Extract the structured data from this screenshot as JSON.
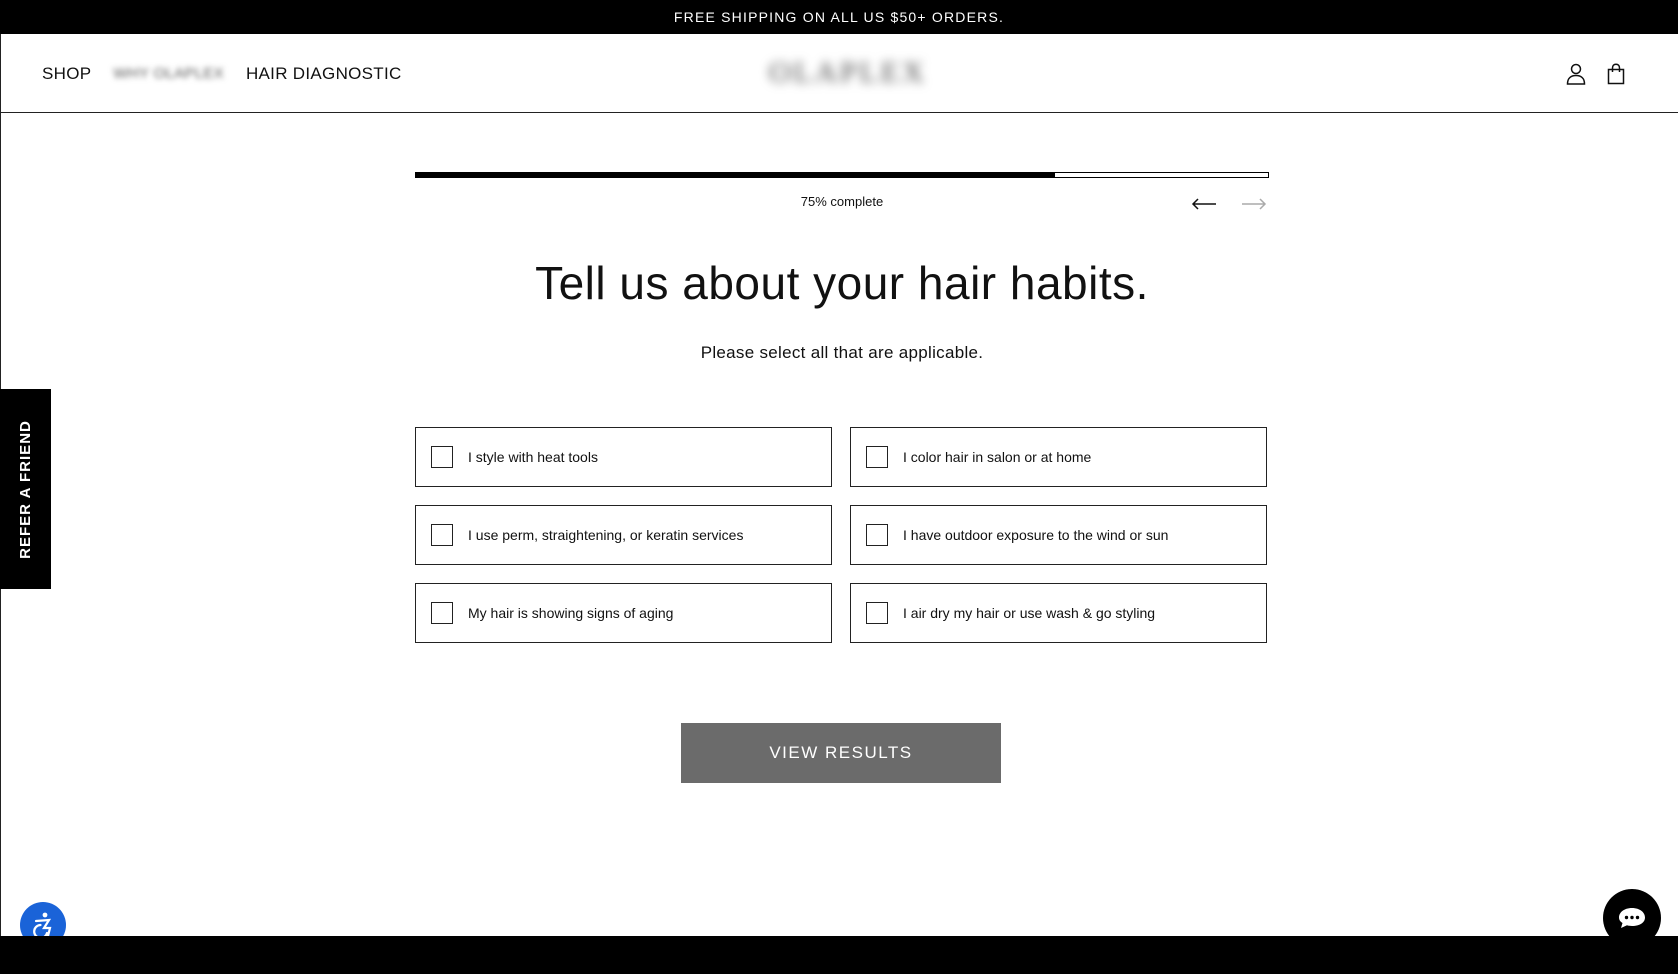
{
  "announcement": "FREE SHIPPING ON ALL US $50+ ORDERS.",
  "nav": {
    "items": [
      {
        "label": "SHOP"
      },
      {
        "label": "WHY OLAPLEX"
      },
      {
        "label": "HAIR DIAGNOSTIC"
      }
    ],
    "logo": "OLAPLEX",
    "icons": [
      "account-icon",
      "shopping-bag-icon"
    ]
  },
  "refer": {
    "label": "REFER A FRIEND"
  },
  "quiz": {
    "progress_percent": 75,
    "progress_label": "75% complete",
    "title": "Tell us about your hair habits.",
    "subtitle": "Please select all that are applicable.",
    "options": [
      {
        "label": "I style with heat tools",
        "checked": false
      },
      {
        "label": "I color hair in salon or at home",
        "checked": false
      },
      {
        "label": "I use perm, straightening, or keratin services",
        "checked": false
      },
      {
        "label": "I have outdoor exposure to the wind or sun",
        "checked": false
      },
      {
        "label": "My hair is showing signs of aging",
        "checked": false
      },
      {
        "label": "I air dry my hair or use wash & go styling",
        "checked": false
      }
    ],
    "results_button": "VIEW RESULTS"
  },
  "colors": {
    "accent": "#000000",
    "button_disabled": "#6b6b6b",
    "accessibility": "#1a63d8"
  },
  "widgets": {
    "accessibility_icon": "accessibility-icon",
    "chat_icon": "chat-icon"
  }
}
